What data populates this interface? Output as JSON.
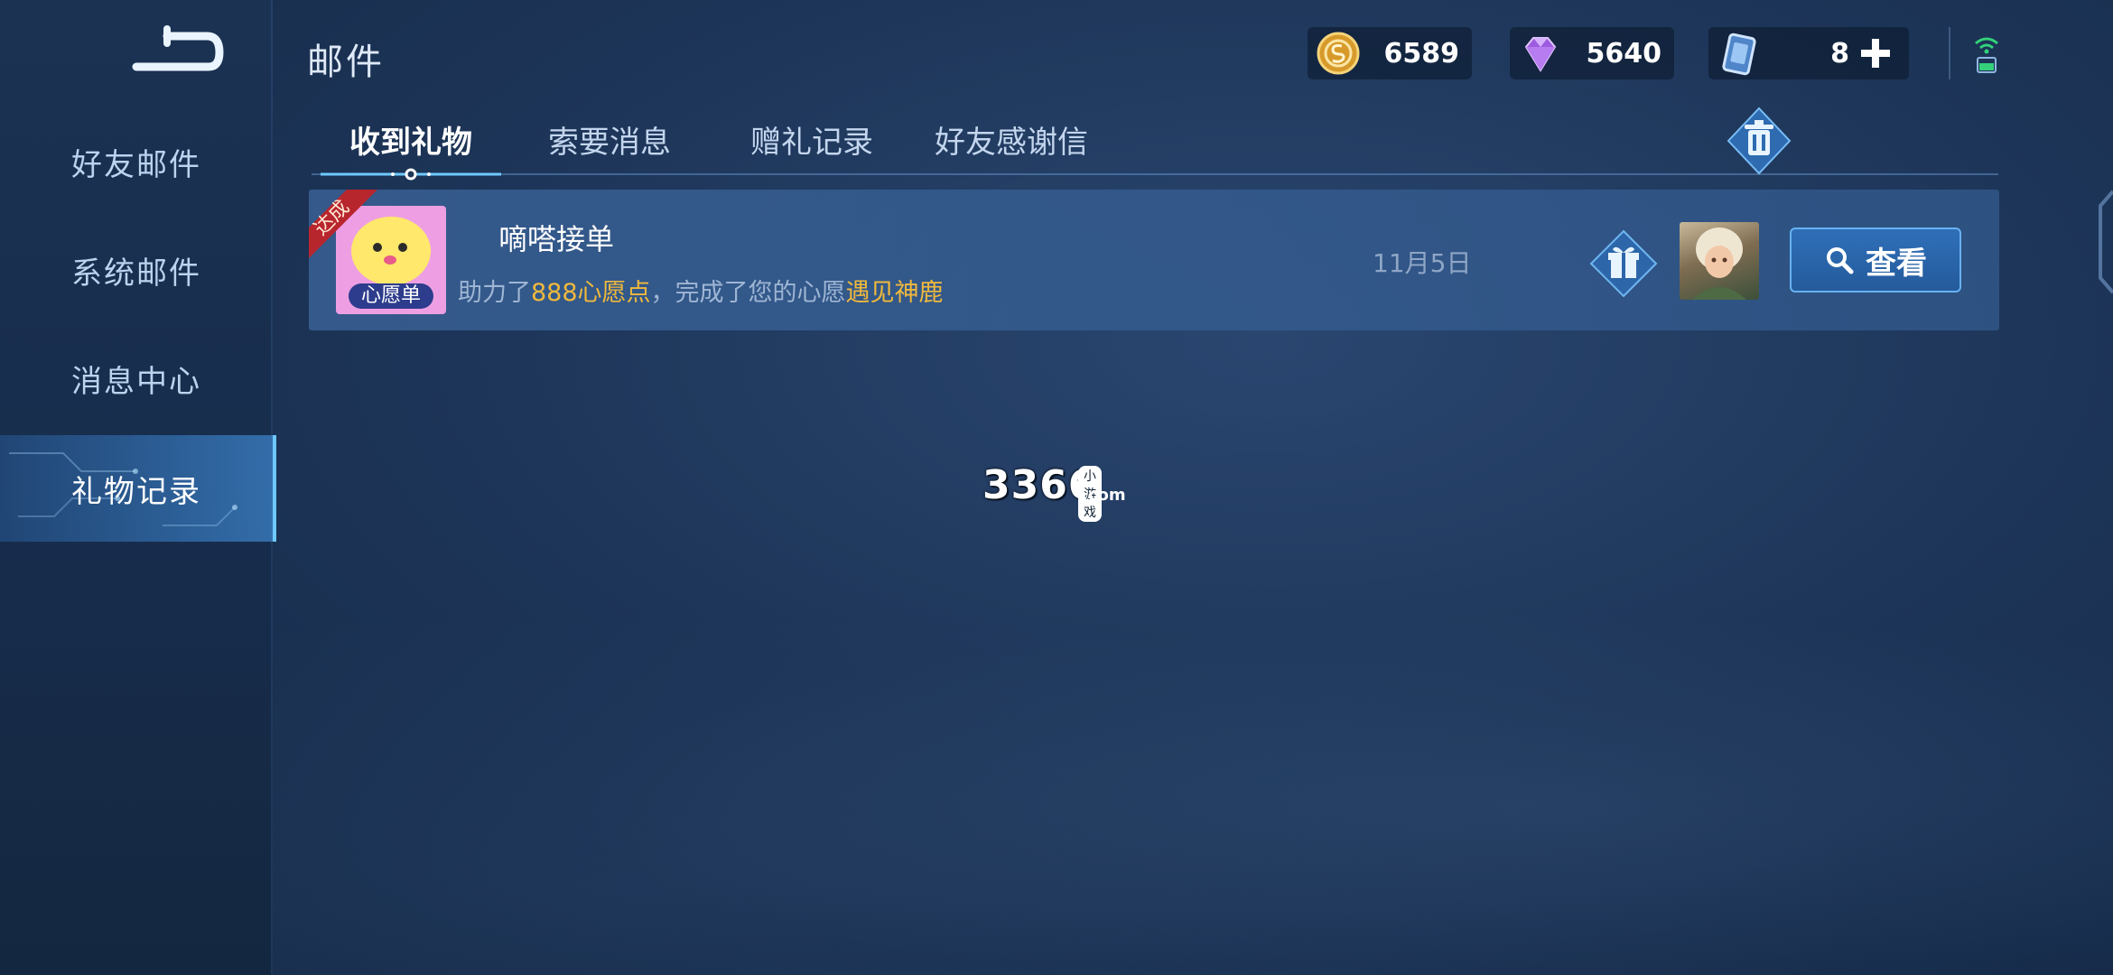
{
  "header": {
    "title": "邮件",
    "currencies": [
      {
        "icon": "gold-coin-icon",
        "value": "6589"
      },
      {
        "icon": "diamond-icon",
        "value": "5640"
      },
      {
        "icon": "ticket-card-icon",
        "value": "8"
      }
    ]
  },
  "sidebar": {
    "items": [
      {
        "label": "好友邮件"
      },
      {
        "label": "系统邮件"
      },
      {
        "label": "消息中心"
      },
      {
        "label": "礼物记录"
      }
    ],
    "active_index": 3
  },
  "tabs": [
    {
      "label": "收到礼物"
    },
    {
      "label": "索要消息"
    },
    {
      "label": "赠礼记录"
    },
    {
      "label": "好友感谢信"
    }
  ],
  "mail": {
    "ribbon": "达成",
    "avatar_label": "心愿单",
    "sender": "嘀嗒接单",
    "desc_prefix": "助力了",
    "desc_highlight1": "888心愿点",
    "desc_middle": "，完成了您的心愿",
    "desc_highlight2": "遇见神鹿",
    "date": "11月5日",
    "view_label": "查看"
  },
  "watermark": {
    "main": "3366",
    "small": "小游戏",
    "com": ".com"
  },
  "colors": {
    "highlight": "#f0b93c",
    "accent": "#6ec8ff",
    "background": "#1d3558"
  }
}
